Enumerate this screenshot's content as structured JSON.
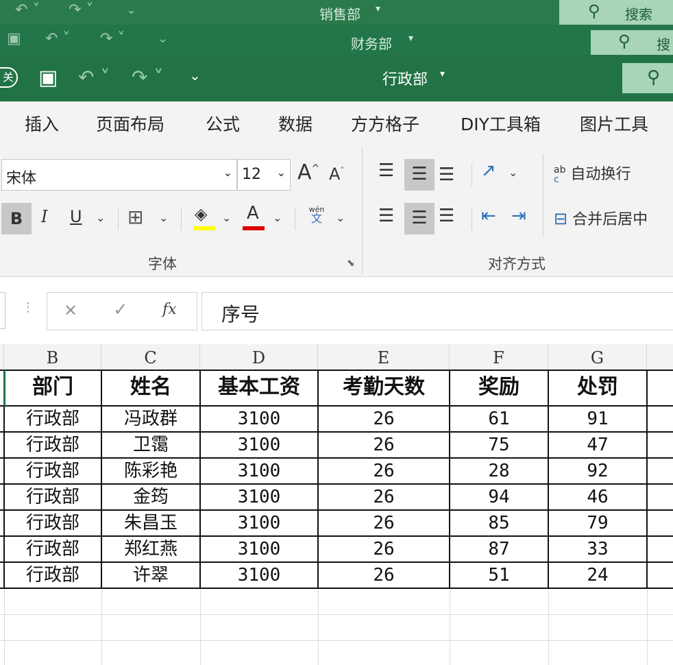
{
  "windows": [
    {
      "title": "销售部",
      "search": "搜索"
    },
    {
      "title": "财务部",
      "search": "搜"
    },
    {
      "title": "行政部",
      "search": ""
    }
  ],
  "autosave_label": "关",
  "ribbon_tabs": [
    "插入",
    "页面布局",
    "公式",
    "数据",
    "方方格子",
    "DIY工具箱",
    "图片工具"
  ],
  "font": {
    "name": "宋体",
    "size": "12"
  },
  "buttons": {
    "bold": "B",
    "italic": "I",
    "underline": "U",
    "grow_font": "A",
    "shrink_font": "A",
    "font_color": "A",
    "phonetic_top": "wén",
    "phonetic_bottom": "文",
    "wrap_text": "自动换行",
    "merge_center": "合并后居中",
    "wrap_icon_top": "ab",
    "wrap_icon_bottom": "c"
  },
  "group_labels": {
    "font": "字体",
    "alignment": "对齐方式"
  },
  "formula_bar": {
    "value": "序号",
    "cancel": "✕",
    "enter": "✓",
    "fx": "fx"
  },
  "colors": {
    "title_bar": "#217346",
    "highlight": "#ffff00",
    "font_color": "#e00000"
  },
  "columns": [
    "B",
    "C",
    "D",
    "E",
    "F",
    "G"
  ],
  "table": {
    "headers": [
      "部门",
      "姓名",
      "基本工资",
      "考勤天数",
      "奖励",
      "处罚"
    ],
    "rows": [
      [
        "行政部",
        "冯政群",
        "3100",
        "26",
        "61",
        "91"
      ],
      [
        "行政部",
        "卫霭",
        "3100",
        "26",
        "75",
        "47"
      ],
      [
        "行政部",
        "陈彩艳",
        "3100",
        "26",
        "28",
        "92"
      ],
      [
        "行政部",
        "金筠",
        "3100",
        "26",
        "94",
        "46"
      ],
      [
        "行政部",
        "朱昌玉",
        "3100",
        "26",
        "85",
        "79"
      ],
      [
        "行政部",
        "郑红燕",
        "3100",
        "26",
        "87",
        "33"
      ],
      [
        "行政部",
        "许翠",
        "3100",
        "26",
        "51",
        "24"
      ]
    ]
  }
}
